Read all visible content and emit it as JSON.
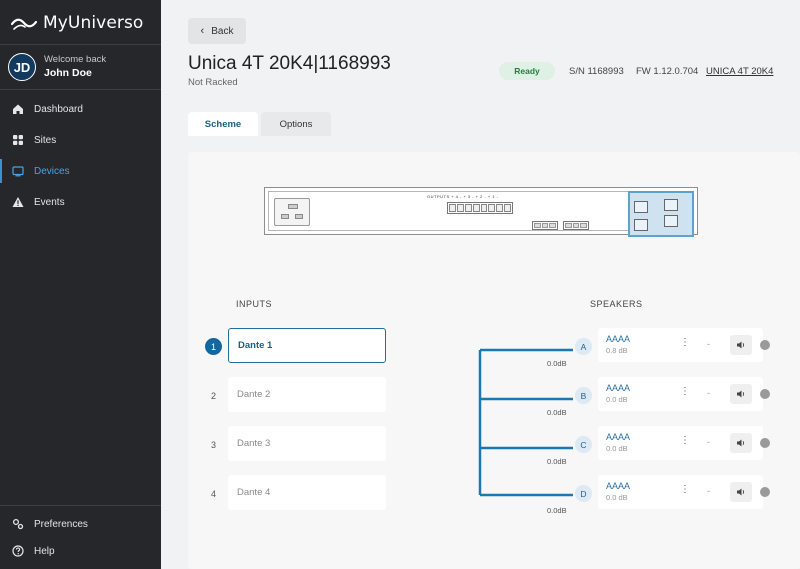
{
  "app": {
    "name": "MyUniverso"
  },
  "user": {
    "initials": "JD",
    "welcome": "Welcome back",
    "name": "John Doe"
  },
  "nav": {
    "items": [
      {
        "label": "Dashboard",
        "icon": "home-icon"
      },
      {
        "label": "Sites",
        "icon": "grid-icon"
      },
      {
        "label": "Devices",
        "icon": "monitor-icon",
        "active": true
      },
      {
        "label": "Events",
        "icon": "warning-icon"
      }
    ],
    "preferences": "Preferences",
    "help": "Help"
  },
  "header": {
    "back_label": "Back",
    "title": "Unica 4T 20K4|1168993",
    "subtitle": "Not Racked",
    "status": "Ready",
    "serial": "S/N 1168993",
    "firmware": "FW 1.12.0.704",
    "model_link": "UNICA 4T 20K4"
  },
  "tabs": [
    {
      "label": "Scheme",
      "active": true
    },
    {
      "label": "Options",
      "active": false
    }
  ],
  "scheme": {
    "inputs_title": "INPUTS",
    "speakers_title": "SPEAKERS",
    "inputs": [
      {
        "num": "1",
        "label": "Dante 1",
        "active": true
      },
      {
        "num": "2",
        "label": "Dante 2",
        "active": false
      },
      {
        "num": "3",
        "label": "Dante 3",
        "active": false
      },
      {
        "num": "4",
        "label": "Dante 4",
        "active": false
      }
    ],
    "speakers": [
      {
        "letter": "A",
        "name": "AAAA",
        "db": "0.8 dB",
        "gain": "0.0dB",
        "dash": "-"
      },
      {
        "letter": "B",
        "name": "AAAA",
        "db": "0.0 dB",
        "gain": "0.0dB",
        "dash": "-"
      },
      {
        "letter": "C",
        "name": "AAAA",
        "db": "0.0 dB",
        "gain": "0.0dB",
        "dash": "-"
      },
      {
        "letter": "D",
        "name": "AAAA",
        "db": "0.0 dB",
        "gain": "0.0dB",
        "dash": "-"
      }
    ]
  },
  "colors": {
    "sidebar": "#25272b",
    "accent": "#1565a0",
    "link": "#4aa3e6",
    "ready": "#dff0e4"
  }
}
